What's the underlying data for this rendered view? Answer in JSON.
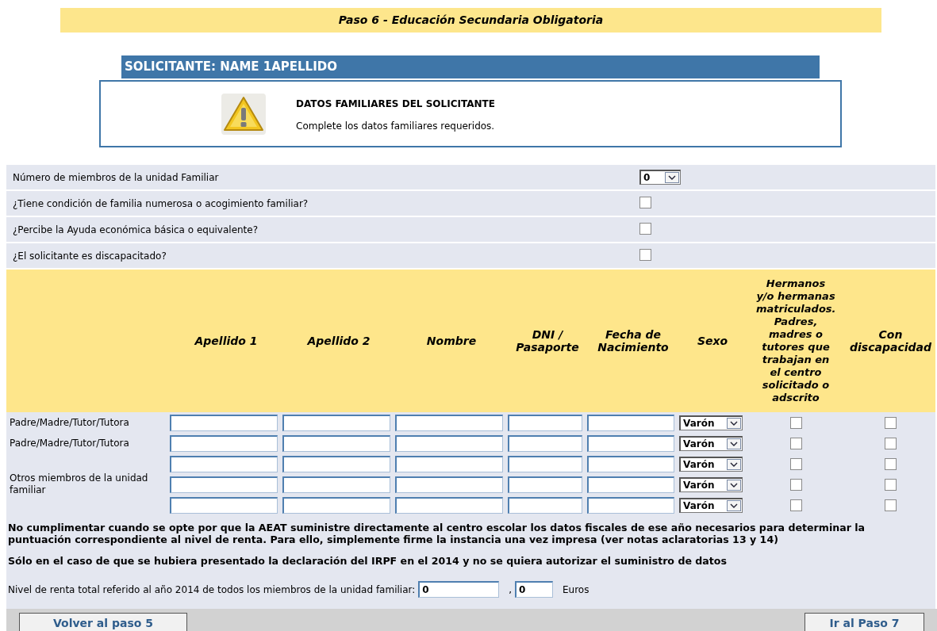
{
  "step_title": "Paso 6 - Educación Secundaria Obligatoria",
  "applicant_header": "SOLICITANTE: NAME 1APELLIDO",
  "notice": {
    "title": "DATOS FAMILIARES DEL SOLICITANTE",
    "message": "Complete los datos familiares requeridos."
  },
  "questions": [
    {
      "kind": "select",
      "label": "Número de miembros de la unidad Familiar",
      "value": "0"
    },
    {
      "kind": "checkbox",
      "label": "¿Tiene condición de familia numerosa o acogimiento familiar?",
      "checked": false
    },
    {
      "kind": "checkbox",
      "label": "¿Percibe la Ayuda económica básica o equivalente?",
      "checked": false
    },
    {
      "kind": "checkbox",
      "label": "¿El solicitante es discapacitado?",
      "checked": false
    }
  ],
  "members_table": {
    "columns": [
      "Apellido 1",
      "Apellido 2",
      "Nombre",
      "DNI / Pasaporte",
      "Fecha de Nacimiento",
      "Sexo",
      "Hermanos y/o hermanas matriculados. Padres, madres o tutores que trabajan en el centro solicitado o adscrito",
      "Con discapacidad"
    ],
    "rows": [
      {
        "label": "Padre/Madre/Tutor/Tutora",
        "sexo": "Varón",
        "siblings_or_parents_at_school": false,
        "disability": false
      },
      {
        "label": "Padre/Madre/Tutor/Tutora",
        "sexo": "Varón",
        "siblings_or_parents_at_school": false,
        "disability": false
      }
    ],
    "other_members": {
      "label": "Otros miembros de la unidad familiar",
      "rows": [
        {
          "sexo": "Varón",
          "siblings_or_parents_at_school": false,
          "disability": false
        },
        {
          "sexo": "Varón",
          "siblings_or_parents_at_school": false,
          "disability": false
        },
        {
          "sexo": "Varón",
          "siblings_or_parents_at_school": false,
          "disability": false
        }
      ]
    }
  },
  "notes": [
    "No cumplimentar cuando se opte por que la AEAT suministre directamente al centro escolar los datos fiscales de ese año necesarios para determinar la puntuación correspondiente al nivel de renta. Para ello, simplemente firme la instancia una vez impresa (ver notas aclaratorias 13 y 14)",
    "Sólo en el caso de que se hubiera presentado la declaración del IRPF en el 2014 y no se quiera autorizar el suministro de datos"
  ],
  "income": {
    "label": "Nivel de renta total referido al año 2014 de todos los miembros de la unidad familiar:",
    "value": "0",
    "separator": ",",
    "decimal_value": "0",
    "unit": "Euros"
  },
  "buttons": {
    "back": "Volver al paso 5",
    "next": "Ir al Paso 7"
  }
}
